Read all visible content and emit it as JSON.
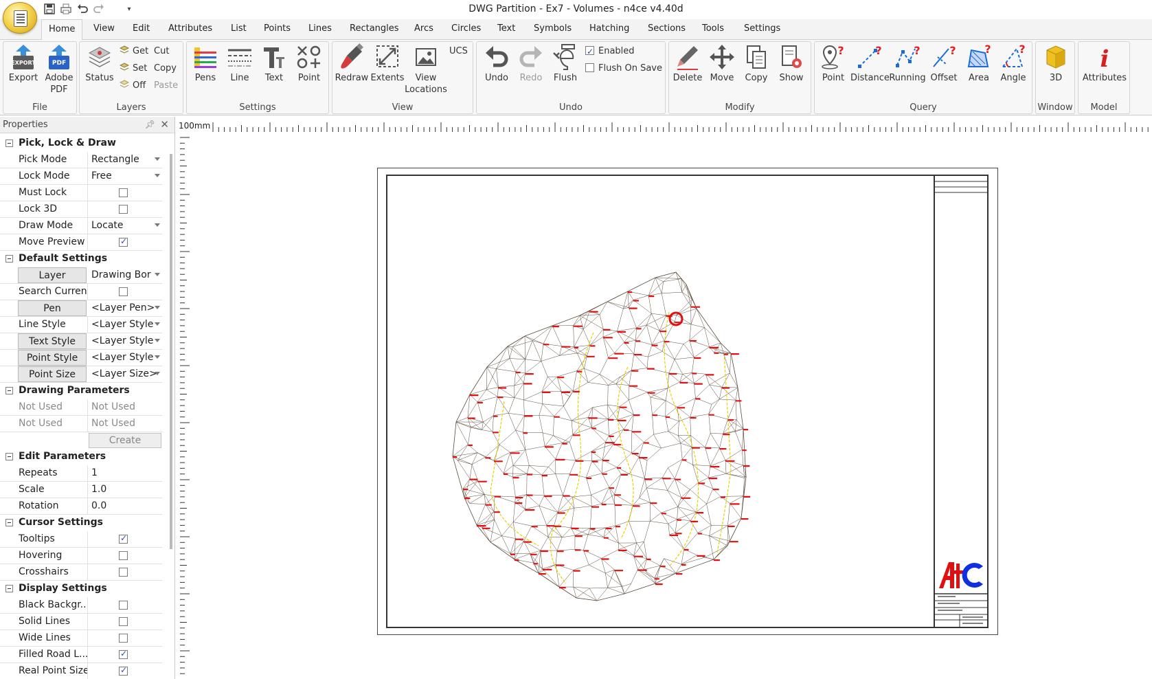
{
  "window": {
    "title": "DWG Partition - Ex7 - Volumes - n4ce v4.40d"
  },
  "tabs": [
    "Home",
    "View",
    "Edit",
    "Attributes",
    "List",
    "Points",
    "Lines",
    "Rectangles",
    "Arcs",
    "Circles",
    "Text",
    "Symbols",
    "Hatching",
    "Sections",
    "Tools",
    "Settings"
  ],
  "ribbon": {
    "file": {
      "label": "File",
      "export": "Export",
      "adobe_pdf_line1": "Adobe",
      "adobe_pdf_line2": "PDF"
    },
    "layers": {
      "label": "Layers",
      "status": "Status",
      "get": "Get",
      "set": "Set",
      "off": "Off",
      "cut": "Cut",
      "copy": "Copy",
      "paste": "Paste"
    },
    "settings": {
      "label": "Settings",
      "pens": "Pens",
      "line": "Line",
      "text": "Text",
      "point": "Point"
    },
    "view": {
      "label": "View",
      "redraw": "Redraw",
      "extents": "Extents",
      "view_locations_line1": "View",
      "view_locations_line2": "Locations",
      "ucs": "UCS"
    },
    "undo": {
      "label": "Undo",
      "undo": "Undo",
      "redo": "Redo",
      "flush": "Flush",
      "enabled": "Enabled",
      "flush_on_save": "Flush On Save"
    },
    "modify": {
      "label": "Modify",
      "delete": "Delete",
      "move": "Move",
      "copy": "Copy",
      "show": "Show"
    },
    "query": {
      "label": "Query",
      "point": "Point",
      "distance": "Distance",
      "running": "Running",
      "offset": "Offset",
      "area": "Area",
      "angle": "Angle"
    },
    "window": {
      "label": "Window",
      "3d": "3D"
    },
    "model": {
      "label": "Model",
      "attributes": "Attributes"
    }
  },
  "properties": {
    "title": "Properties",
    "sections": {
      "pick": {
        "title": "Pick, Lock & Draw",
        "pick_mode": {
          "name": "Pick Mode",
          "value": "Rectangle"
        },
        "lock_mode": {
          "name": "Lock Mode",
          "value": "Free"
        },
        "must_lock": {
          "name": "Must Lock",
          "checked": false
        },
        "lock_3d": {
          "name": "Lock 3D",
          "checked": false
        },
        "draw_mode": {
          "name": "Draw Mode",
          "value": "Locate"
        },
        "move_preview": {
          "name": "Move Preview",
          "checked": true
        }
      },
      "defaults": {
        "title": "Default Settings",
        "layer": {
          "name": "Layer",
          "value": "Drawing Bor"
        },
        "search_current": {
          "name": "Search Current",
          "checked": false
        },
        "pen": {
          "name": "Pen",
          "value": "<Layer Pen>"
        },
        "line_style": {
          "name": "Line Style",
          "value": "<Layer Style"
        },
        "text_style": {
          "name": "Text Style",
          "value": "<Layer Style"
        },
        "point_style": {
          "name": "Point Style",
          "value": "<Layer Style"
        },
        "point_size": {
          "name": "Point Size",
          "value": "<Layer Size>"
        }
      },
      "drawing": {
        "title": "Drawing Parameters",
        "row1": {
          "name": "Not Used",
          "value": "Not Used"
        },
        "row2": {
          "name": "Not Used",
          "value": "Not Used"
        },
        "create": "Create"
      },
      "edit": {
        "title": "Edit Parameters",
        "repeats": {
          "name": "Repeats",
          "value": "1"
        },
        "scale": {
          "name": "Scale",
          "value": "1.0"
        },
        "rotation": {
          "name": "Rotation",
          "value": "0.0"
        }
      },
      "cursor": {
        "title": "Cursor Settings",
        "tooltips": {
          "name": "Tooltips",
          "checked": true
        },
        "hovering": {
          "name": "Hovering",
          "checked": false
        },
        "crosshairs": {
          "name": "Crosshairs",
          "checked": false
        }
      },
      "display": {
        "title": "Display Settings",
        "black_background": {
          "name": "Black Backgr...",
          "checked": false
        },
        "solid_lines": {
          "name": "Solid Lines",
          "checked": false
        },
        "wide_lines": {
          "name": "Wide Lines",
          "checked": false
        },
        "filled_road": {
          "name": "Filled Road L...",
          "checked": true
        },
        "real_point_size": {
          "name": "Real Point Size",
          "checked": true
        }
      }
    }
  },
  "canvas": {
    "ruler_label": "100mm"
  },
  "colors": {
    "mesh": "#5a4a3a",
    "label_red": "#e01010",
    "contour_yellow": "#e8d000",
    "logo_red": "#e01010",
    "logo_blue": "#1030e0"
  },
  "icons": {
    "save": "save-icon",
    "print": "print-icon",
    "undo": "undo-icon",
    "redo": "redo-icon"
  }
}
